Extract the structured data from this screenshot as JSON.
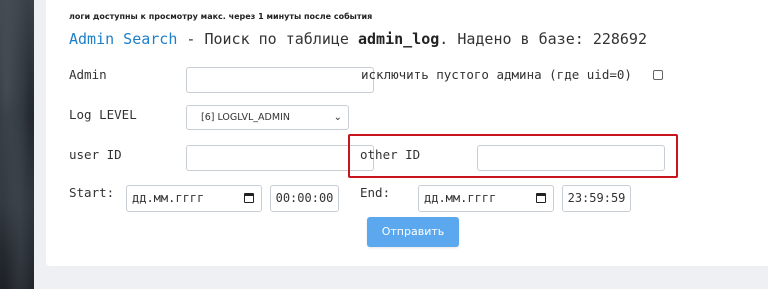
{
  "note": "логи доступны к просмотру макс. через 1 минуты после события",
  "heading": {
    "link": "Admin Search",
    "dash": " - Поиск по таблице ",
    "table": "admin_log",
    "found_label": ". Надено в базе: ",
    "count": "228692"
  },
  "form": {
    "admin_label": "Admin",
    "admin_value": "",
    "exclude_label": "исключить пустого админа (где uid=0)",
    "log_level_label": "Log LEVEL",
    "log_level_value": "[6] LOGLVL_ADMIN",
    "user_id_label": "user ID",
    "user_id_value": "",
    "other_id_label": "other ID",
    "other_id_value": "",
    "start_label": "Start:",
    "start_date_placeholder": "дд.мм.гггг",
    "start_time": "00:00:00",
    "end_label": "End:",
    "end_date_placeholder": "дд.мм.гггг",
    "end_time": "23:59:59",
    "submit_label": "Отправить"
  },
  "colors": {
    "link": "#1e7fc9",
    "button": "#5ba8ee",
    "highlight": "#c8141c"
  }
}
